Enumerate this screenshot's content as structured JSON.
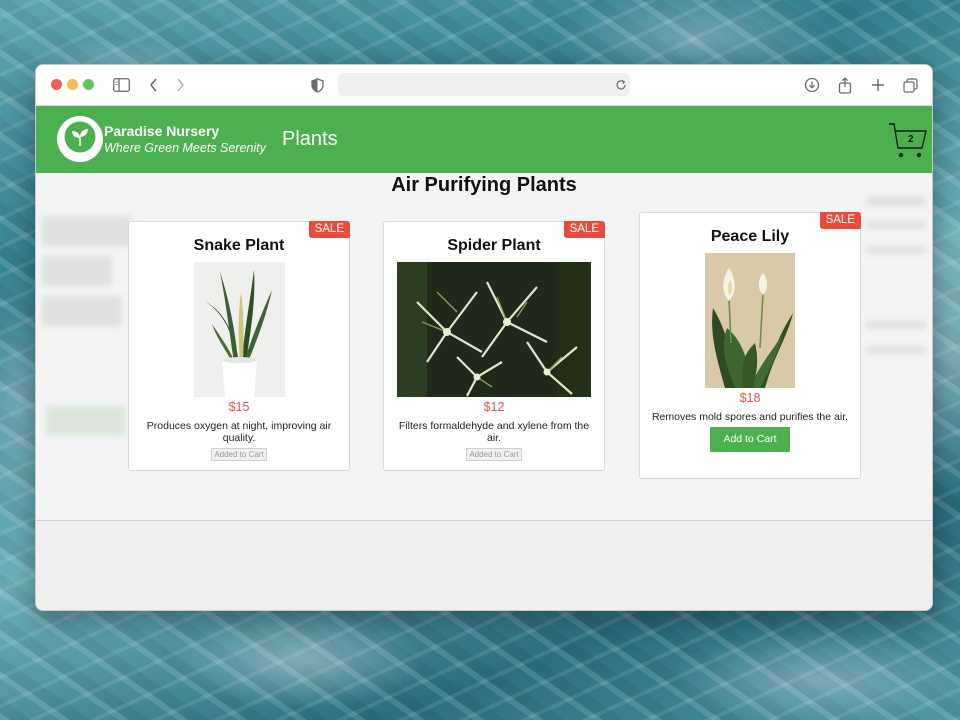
{
  "browser": {
    "traffic_lights": [
      "close",
      "minimize",
      "zoom"
    ],
    "url": ""
  },
  "nav": {
    "brand_name": "Paradise Nursery",
    "tagline": "Where Green Meets Serenity",
    "link_plants": "Plants",
    "cart_count": "2",
    "brand_color": "#4caf50"
  },
  "section": {
    "title": "Air Purifying Plants"
  },
  "products": [
    {
      "name": "Snake Plant",
      "badge": "SALE",
      "price": "$15",
      "description": "Produces oxygen at night, improving air quality.",
      "button": "Added to Cart",
      "in_cart": true
    },
    {
      "name": "Spider Plant",
      "badge": "SALE",
      "price": "$12",
      "description": "Filters formaldehyde and xylene from the air.",
      "button": "Added to Cart",
      "in_cart": true
    },
    {
      "name": "Peace Lily",
      "badge": "SALE",
      "price": "$18",
      "description": "Removes mold spores and purifies the air.",
      "button": "Add to Cart",
      "in_cart": false
    }
  ],
  "colors": {
    "sale_badge": "#e84c3d",
    "price": "#e0533f"
  }
}
